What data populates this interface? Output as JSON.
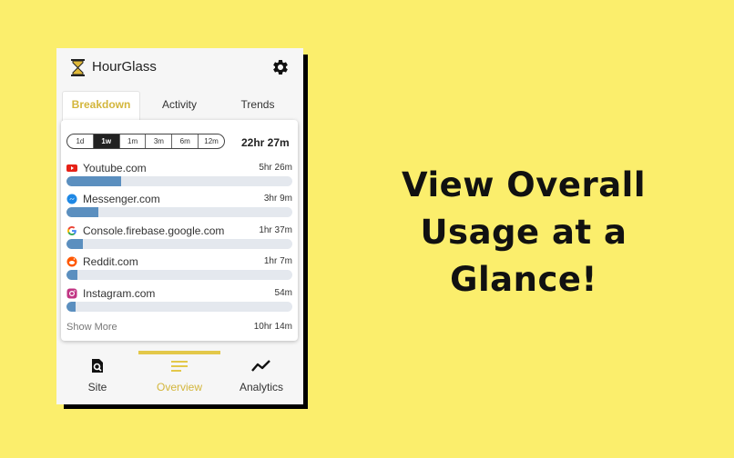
{
  "app": {
    "title": "HourGlass",
    "icon": "hourglass-icon",
    "settings_icon": "gear-icon"
  },
  "tabs": [
    {
      "label": "Breakdown",
      "active": true
    },
    {
      "label": "Activity",
      "active": false
    },
    {
      "label": "Trends",
      "active": false
    }
  ],
  "ranges": [
    {
      "label": "1d",
      "active": false
    },
    {
      "label": "1w",
      "active": true
    },
    {
      "label": "1m",
      "active": false
    },
    {
      "label": "3m",
      "active": false
    },
    {
      "label": "6m",
      "active": false
    },
    {
      "label": "12m",
      "active": false
    }
  ],
  "total_time": "22hr 27m",
  "sites": [
    {
      "name": "Youtube.com",
      "time": "5hr 26m",
      "fraction": 0.242,
      "icon": "youtube-icon",
      "color": "#e62117"
    },
    {
      "name": "Messenger.com",
      "time": "3hr 9m",
      "fraction": 0.14,
      "icon": "messenger-icon",
      "color": "#1e88e5"
    },
    {
      "name": "Console.firebase.google.com",
      "time": "1hr 37m",
      "fraction": 0.072,
      "icon": "google-icon",
      "color": "#4285f4"
    },
    {
      "name": "Reddit.com",
      "time": "1hr 7m",
      "fraction": 0.05,
      "icon": "reddit-icon",
      "color": "#ff5700"
    },
    {
      "name": "Instagram.com",
      "time": "54m",
      "fraction": 0.04,
      "icon": "instagram-icon",
      "color": "#c13584"
    }
  ],
  "show_more": {
    "label": "Show More",
    "time": "10hr 14m"
  },
  "nav": [
    {
      "label": "Site",
      "icon": "site-search-icon",
      "active": false
    },
    {
      "label": "Overview",
      "icon": "overview-lines-icon",
      "active": true
    },
    {
      "label": "Analytics",
      "icon": "analytics-trend-icon",
      "active": false
    }
  ],
  "colors": {
    "background": "#fbee6c",
    "accent": "#d3b63c",
    "bar": "#5b8fbf"
  },
  "headline": {
    "line1": "View Overall",
    "line2": "Usage at a",
    "line3": "Glance!"
  }
}
